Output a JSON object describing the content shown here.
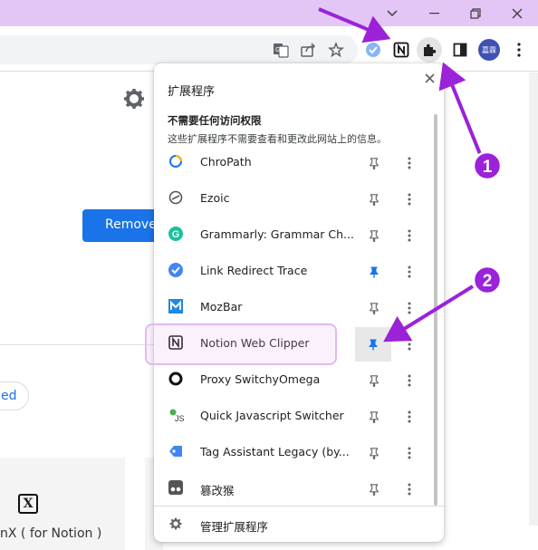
{
  "window": {
    "minimize": "⌄",
    "restore": "–",
    "maximize": "❐",
    "close": "✕"
  },
  "toolbar": {
    "avatar_text": "嘉霖"
  },
  "page": {
    "remove_label": "Remove",
    "chip_label": "ed",
    "notionx_logo": "X",
    "notionx_label": "nX ( for Notion )"
  },
  "popup": {
    "title": "扩展程序",
    "close": "✕",
    "section_title": "不需要任何访问权限",
    "section_desc": "这些扩展程序不需要查看和更改此网站上的信息。",
    "items": [
      {
        "name": "ChroPath",
        "icon": "chropath-icon",
        "pinned": false
      },
      {
        "name": "Ezoic",
        "icon": "ezoic-icon",
        "pinned": false
      },
      {
        "name": "Grammarly: Grammar Ch...",
        "icon": "grammarly-icon",
        "pinned": false
      },
      {
        "name": "Link Redirect Trace",
        "icon": "link-redirect-trace-icon",
        "pinned": true
      },
      {
        "name": "MozBar",
        "icon": "mozbar-icon",
        "pinned": false
      },
      {
        "name": "Notion Web Clipper",
        "icon": "notion-icon",
        "pinned": true
      },
      {
        "name": "Proxy SwitchyOmega",
        "icon": "switchyomega-icon",
        "pinned": false
      },
      {
        "name": "Quick Javascript Switcher",
        "icon": "js-switcher-icon",
        "pinned": false
      },
      {
        "name": "Tag Assistant Legacy (by...",
        "icon": "tag-assistant-icon",
        "pinned": false
      },
      {
        "name": "篡改猴",
        "icon": "tampermonkey-icon",
        "pinned": false
      }
    ],
    "footer_label": "管理扩展程序"
  },
  "annotations": {
    "badge_1": "1",
    "badge_2": "2"
  },
  "colors": {
    "accent": "#1a73e8",
    "arrow": "#9b22d8",
    "titlebar": "#e3c6f6",
    "pin_active": "#1a73e8",
    "pin_inactive": "#5f6368"
  }
}
